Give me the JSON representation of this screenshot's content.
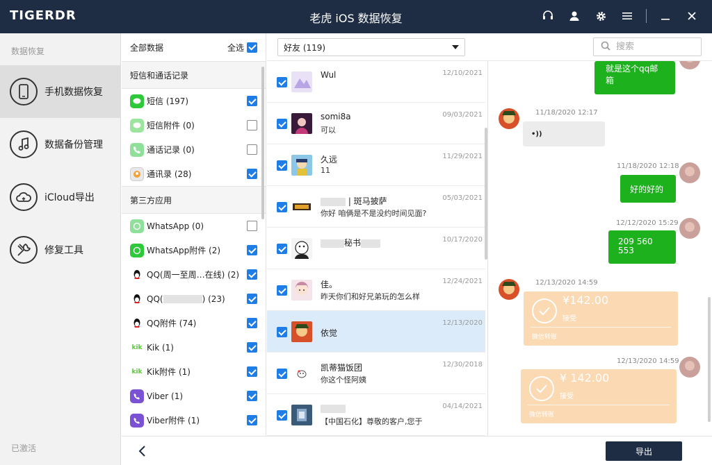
{
  "app": {
    "logo": "TIGERDR",
    "window_title": "老虎 iOS 数据恢复"
  },
  "titlebar_icons": [
    "headset-icon",
    "user-icon",
    "gear-icon",
    "menu-icon",
    "minimize-icon",
    "close-icon"
  ],
  "nav": {
    "section": "数据恢复",
    "items": [
      {
        "label": "手机数据恢复",
        "icon": "phone-icon",
        "active": true
      },
      {
        "label": "数据备份管理",
        "icon": "music-note-icon",
        "active": false
      },
      {
        "label": "iCloud导出",
        "icon": "cloud-icon",
        "active": false
      },
      {
        "label": "修复工具",
        "icon": "wrench-icon",
        "active": false
      }
    ],
    "footer": "已激活"
  },
  "categories": {
    "all_label": "全部数据",
    "select_all_label": "全选",
    "select_all_checked": true,
    "groups": [
      {
        "title": "短信和通话记录",
        "items": [
          {
            "label": "短信 (197)",
            "icon": "sms-icon",
            "checked": true
          },
          {
            "label": "短信附件 (0)",
            "icon": "sms-attachment-icon",
            "checked": false
          },
          {
            "label": "通话记录 (0)",
            "icon": "phone-call-icon",
            "checked": false
          },
          {
            "label": "通讯录 (28)",
            "icon": "contacts-icon",
            "checked": true
          }
        ]
      },
      {
        "title": "第三方应用",
        "items": [
          {
            "label": "WhatsApp (0)",
            "icon": "whatsapp-icon",
            "checked": false
          },
          {
            "label": "WhatsApp附件 (2)",
            "icon": "whatsapp-icon",
            "checked": true
          },
          {
            "label": "QQ(周一至周…在线) (2)",
            "icon": "qq-icon",
            "checked": true
          },
          {
            "label": "QQ(",
            "label_suffix": ") (23)",
            "icon": "qq-icon",
            "checked": true
          },
          {
            "label": "QQ附件 (74)",
            "icon": "qq-icon",
            "checked": true
          },
          {
            "label": "Kik (1)",
            "icon": "kik-icon",
            "checked": true
          },
          {
            "label": "Kik附件 (1)",
            "icon": "kik-icon",
            "checked": true
          },
          {
            "label": "Viber (1)",
            "icon": "viber-icon",
            "checked": true
          },
          {
            "label": "Viber附件 (1)",
            "icon": "viber-icon",
            "checked": true
          }
        ]
      }
    ]
  },
  "toolbar": {
    "filter_value": "好友 (119)",
    "search_placeholder": "搜索"
  },
  "contacts": [
    {
      "name": "Wul",
      "message": "",
      "date": "12/10/2021",
      "checked": true,
      "selected": false
    },
    {
      "name": "somi8a",
      "message": "可以",
      "date": "09/03/2021",
      "checked": true,
      "selected": false
    },
    {
      "name": "久远",
      "message": "11",
      "date": "11/29/2021",
      "checked": true,
      "selected": false
    },
    {
      "name": "| 斑马披萨",
      "message": "你好 咱俩是不是没约时间见面?",
      "date": "05/03/2021",
      "checked": true,
      "selected": false
    },
    {
      "name": "秘书",
      "message": "",
      "date": "10/17/2020",
      "checked": true,
      "selected": false
    },
    {
      "name": "佳。",
      "message": "昨天你们和好兄弟玩的怎么样",
      "date": "12/24/2021",
      "checked": true,
      "selected": false
    },
    {
      "name": "依觉",
      "message": "",
      "date": "12/13/2020",
      "checked": true,
      "selected": true
    },
    {
      "name": "凯蒂猫饭团",
      "message": "你这个怪阿姨",
      "date": "12/30/2018",
      "checked": true,
      "selected": false
    },
    {
      "name": "",
      "message": "【中国石化】尊敬的客户,您于",
      "date": "04/14/2021",
      "checked": true,
      "selected": false
    }
  ],
  "chat": {
    "msg1": {
      "text_line1": "就是这个qq邮",
      "text_line2": "箱"
    },
    "msg2": {
      "time": "11/18/2020 12:17",
      "text": "•))"
    },
    "msg3": {
      "time": "11/18/2020 12:18",
      "text": "好的好的"
    },
    "msg4": {
      "time": "12/12/2020 15:29",
      "text_line1": "209 560",
      "text_line2": "553"
    },
    "msg5": {
      "time": "12/13/2020 14:59",
      "amount": "¥142.00",
      "status": "接受",
      "source": "微信转账"
    },
    "msg6": {
      "time": "12/13/2020 14:59",
      "amount": "¥ 142.00",
      "status": "接受",
      "source": "微信转账"
    }
  },
  "bottom": {
    "export_label": "导出"
  }
}
